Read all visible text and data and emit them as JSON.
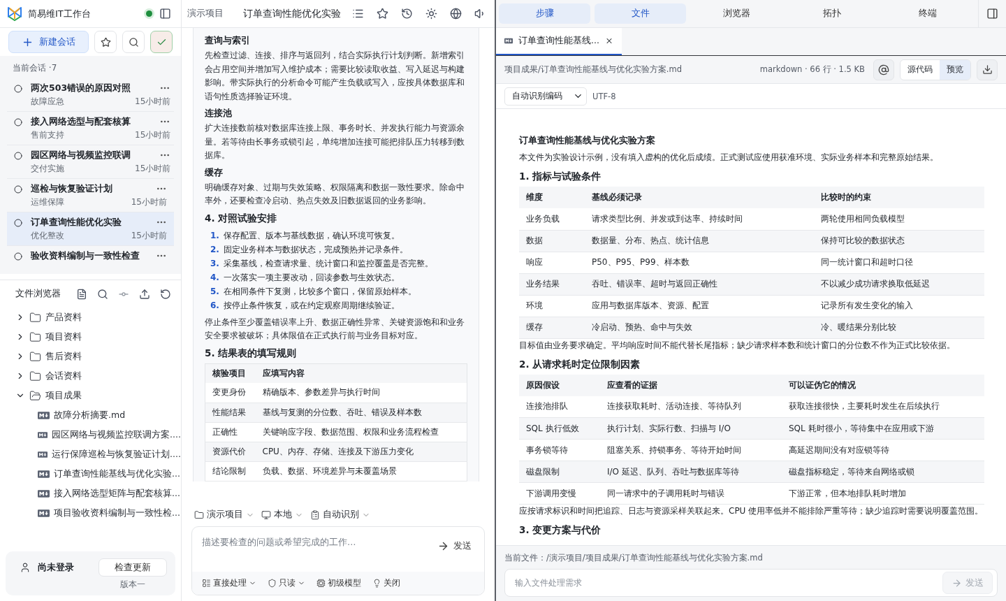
{
  "app": {
    "title": "简易维IT工作台",
    "online": true
  },
  "sidebar": {
    "new_chat": "新建会话",
    "sessions_label": "当前会话 ·7",
    "sessions": [
      {
        "title": "两次503错误的原因对照",
        "category": "故障应急",
        "time": "15小时前",
        "selected": false
      },
      {
        "title": "接入网络选型与配套核算",
        "category": "售前支持",
        "time": "15小时前",
        "selected": false
      },
      {
        "title": "园区网络与视频监控联调",
        "category": "交付实施",
        "time": "15小时前",
        "selected": false
      },
      {
        "title": "巡检与恢复验证计划",
        "category": "运维保障",
        "time": "15小时前",
        "selected": false
      },
      {
        "title": "订单查询性能优化实验",
        "category": "优化整改",
        "time": "15小时前",
        "selected": true
      },
      {
        "title": "验收资料编制与一致性检查",
        "selected": false
      }
    ]
  },
  "file_browser": {
    "title": "文件浏览器",
    "tree": [
      {
        "name": "产品资料",
        "kind": "folder",
        "expanded": false
      },
      {
        "name": "项目资料",
        "kind": "folder",
        "expanded": false
      },
      {
        "name": "售后资料",
        "kind": "folder",
        "expanded": false
      },
      {
        "name": "会话资料",
        "kind": "folder",
        "expanded": false
      },
      {
        "name": "项目成果",
        "kind": "folder",
        "expanded": true,
        "children": [
          {
            "name": "故障分析摘要.md",
            "kind": "file"
          },
          {
            "name": "园区网络与视频监控联调方案....",
            "kind": "file"
          },
          {
            "name": "运行保障巡检与恢复验证计划....",
            "kind": "file"
          },
          {
            "name": "订单查询性能基线与优化实验...",
            "kind": "file"
          },
          {
            "name": "接入网络选型矩阵与配套核算...",
            "kind": "file"
          },
          {
            "name": "项目验收资料编制与一致性检...",
            "kind": "file"
          }
        ]
      }
    ]
  },
  "user": {
    "name": "尚未登录",
    "update_button": "检查更新",
    "version": "版本一"
  },
  "chat": {
    "breadcrumb": "演示项目",
    "title": "订单查询性能优化实验",
    "content": [
      {
        "kind": "subheading",
        "text": "查询与索引"
      },
      {
        "kind": "paragraph",
        "text": "先检查过滤、连接、排序与返回列，结合实际执行计划判断。新增索引会占用空间并增加写入维护成本；需要比较读取收益、写入延迟与构建影响。带实际执行的分析命令可能产生负载或写入，应按具体数据库和语句性质选择验证环境。"
      },
      {
        "kind": "subheading",
        "text": "连接池"
      },
      {
        "kind": "paragraph",
        "text": "扩大连接数前核对数据库连接上限、事务时长、并发执行能力与资源余量。若等待由长事务或锁引起，单纯增加连接可能把排队压力转移到数据库。"
      },
      {
        "kind": "subheading",
        "text": "缓存"
      },
      {
        "kind": "paragraph",
        "text": "明确缓存对象、过期与失效策略、权限隔离和数据一致性要求。除命中率外，还要检查冷启动、热点失效及旧数据返回的业务影响。"
      },
      {
        "kind": "heading",
        "text": "4. 对照试验安排"
      },
      {
        "kind": "ordered_list",
        "items": [
          {
            "number": "1.",
            "text": "保存配置、版本与基线数据，确认环境可恢复。"
          },
          {
            "number": "2.",
            "text": "固定业务样本与数据状态，完成预热并记录条件。"
          },
          {
            "number": "3.",
            "text": "采集基线，检查请求量、统计窗口和监控覆盖是否完整。"
          },
          {
            "number": "4.",
            "text": "一次落实一项主要改动，回读参数与生效状态。"
          },
          {
            "number": "5.",
            "text": "在相同条件下复测，比较多个窗口，保留原始样本。"
          },
          {
            "number": "6.",
            "text": "按停止条件恢复，或在约定观察周期继续验证。"
          }
        ]
      },
      {
        "kind": "paragraph",
        "text": "停止条件至少覆盖错误率上升、数据正确性异常、关键资源饱和和业务安全要求被破坏；具体限值在正式执行前与业务目标对应。"
      },
      {
        "kind": "heading",
        "text": "5. 结果表的填写规则"
      },
      {
        "kind": "table",
        "columns": [
          "核验项目",
          "应填写内容"
        ],
        "rows": [
          [
            "变更身份",
            "精确版本、参数差异与执行时间"
          ],
          [
            "性能结果",
            "基线与复测的分位数、吞吐、错误及样本数"
          ],
          [
            "正确性",
            "关键响应字段、数据范围、权限和业务流程检查"
          ],
          [
            "资源代价",
            "CPU、内存、存储、连接及下游压力变化"
          ],
          [
            "结论限制",
            "负载、数据、环境差异与未覆盖场景"
          ]
        ]
      }
    ],
    "selectors": [
      "演示项目",
      "本地",
      "自动识别"
    ],
    "composer": {
      "placeholder": "描述要检查的问题或希望完成的工作…",
      "send": "发送",
      "options": [
        "直接处理",
        "只读",
        "初级模型",
        "关闭"
      ]
    }
  },
  "panel": {
    "tabs": [
      {
        "label": "步骤",
        "selected": true
      },
      {
        "label": "文件",
        "selected": true
      },
      {
        "label": "浏览器",
        "selected": false
      },
      {
        "label": "拓扑",
        "selected": false
      },
      {
        "label": "终端",
        "selected": false
      }
    ],
    "file_tab": "订单查询性能基线...",
    "path": "项目成果/订单查询性能基线与优化实验方案.md",
    "meta": "markdown · 66 行 · 1.5 KB",
    "views": [
      {
        "label": "源代码",
        "selected": false
      },
      {
        "label": "预览",
        "selected": true
      }
    ],
    "encoding": "自动识别编码",
    "charset": "UTF-8",
    "doc": [
      {
        "kind": "title",
        "text": "订单查询性能基线与优化实验方案"
      },
      {
        "kind": "paragraph",
        "text": "本文件为实验设计示例，没有填入虚构的优化后成绩。正式测试应使用获准环境、实际业务样本和完整原始结果。"
      },
      {
        "kind": "heading",
        "text": "1. 指标与试验条件"
      },
      {
        "kind": "table",
        "columns": [
          "维度",
          "基线必须记录",
          "比较时的约束"
        ],
        "rows": [
          [
            "业务负载",
            "请求类型比例、并发或到达率、持续时间",
            "两轮使用相同负载模型"
          ],
          [
            "数据",
            "数据量、分布、热点、统计信息",
            "保持可比较的数据状态"
          ],
          [
            "响应",
            "P50、P95、P99、样本数",
            "同一统计窗口和超时口径"
          ],
          [
            "业务结果",
            "吞吐、错误率、超时与返回正确性",
            "不以减少成功请求换取低延迟"
          ],
          [
            "环境",
            "应用与数据库版本、资源、配置",
            "记录所有发生变化的输入"
          ],
          [
            "缓存",
            "冷启动、预热、命中与失效",
            "冷、暖结果分别比较"
          ]
        ]
      },
      {
        "kind": "paragraph",
        "text": "目标值由业务要求确定。平均响应时间不能代替长尾指标；缺少请求样本数和统计窗口的分位数不作为正式比较依据。"
      },
      {
        "kind": "heading",
        "text": "2. 从请求耗时定位限制因素"
      },
      {
        "kind": "table",
        "columns": [
          "原因假设",
          "应查看的证据",
          "可以证伪它的情况"
        ],
        "rows": [
          [
            "连接池排队",
            "连接获取耗时、活动连接、等待队列",
            "获取连接很快，主要耗时发生在后续执行"
          ],
          [
            "SQL 执行低效",
            "执行计划、实际行数、扫描与 I/O",
            "SQL 耗时很小，等待集中在应用或下游"
          ],
          [
            "事务锁等待",
            "阻塞关系、持锁事务、等待开始时间",
            "高延迟期间没有对应锁等待"
          ],
          [
            "磁盘限制",
            "I/O 延迟、队列、吞吐与数据库等待",
            "磁盘指标稳定，等待来自网络或锁"
          ],
          [
            "下游调用变慢",
            "同一请求中的子调用耗时与错误",
            "下游正常，但本地排队耗时增加"
          ]
        ]
      },
      {
        "kind": "paragraph",
        "text": "应按请求标识和时间把追踪、日志与资源采样关联起来。CPU 使用率低并不能排除严重等待；缺少追踪时需要说明覆盖范围。"
      },
      {
        "kind": "heading",
        "text": "3. 变更方案与代价"
      }
    ],
    "current_file": "当前文件：/演示项目/项目成果/订单查询性能基线与优化实验方案.md",
    "input": {
      "placeholder": "输入文件处理需求",
      "send": "发送",
      "disabled": true
    }
  }
}
